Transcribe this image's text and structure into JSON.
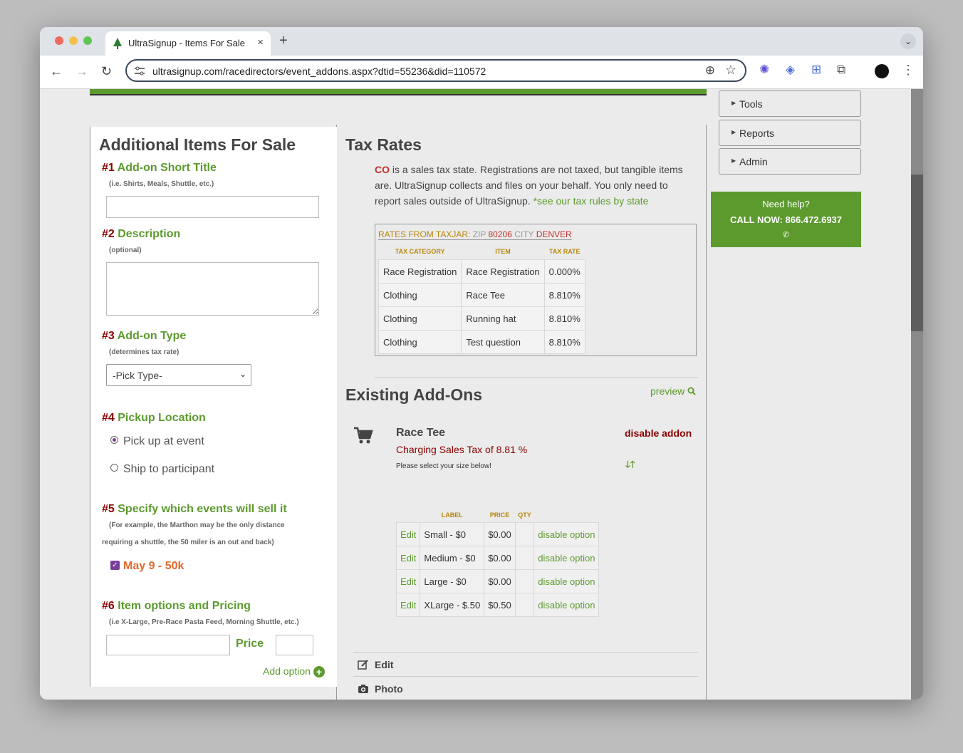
{
  "browser": {
    "tab_title": "UltraSignup - Items For Sale",
    "tab_close": "×",
    "new_tab": "+",
    "tab_menu": "⌄",
    "url": "ultrasignup.com/racedirectors/event_addons.aspx?dtid=55236&did=110572",
    "back": "←",
    "forward": "→",
    "reload": "↻",
    "zoom": "⊕",
    "star": "☆",
    "more": "⋮"
  },
  "colors": {
    "accent_green": "#5c9a2e",
    "dark_red": "#8b0000",
    "orange": "#e06a2b",
    "purple": "#7b3f98"
  },
  "left": {
    "title": "Additional Items For Sale",
    "step1": {
      "num": "#1",
      "label": "Add-on Short Title",
      "hint": "(i.e. Shirts, Meals, Shuttle, etc.)",
      "value": ""
    },
    "step2": {
      "num": "#2",
      "label": "Description",
      "hint": "(optional)",
      "value": ""
    },
    "step3": {
      "num": "#3",
      "label": "Add-on Type",
      "hint": "(determines tax rate)",
      "selected": "-Pick Type-"
    },
    "step4": {
      "num": "#4",
      "label": "Pickup Location",
      "options": [
        "Pick up at event",
        "Ship to participant"
      ],
      "selected_index": 0
    },
    "step5": {
      "num": "#5",
      "label": "Specify which events will sell it",
      "hint_line1": "(For example, the Marthon may be the only distance",
      "hint_line2": "requiring a shuttle, the 50 miler is an out and back)",
      "event": "May 9 - 50k",
      "checked": true
    },
    "step6": {
      "num": "#6",
      "label": "Item options and Pricing",
      "hint": "(i.e X-Large, Pre-Race Pasta Feed, Morning Shuttle, etc.)",
      "price_label": "Price",
      "add_option": "Add option"
    }
  },
  "tax": {
    "title": "Tax Rates",
    "state": "CO",
    "para": " is a sales tax state. Registrations are not taxed, but tangible items are. UltraSignup collects and files on your behalf. You only need to report sales outside of UltraSignup. ",
    "link": "*see our tax rules by state",
    "rates_label": "RATES FROM TAXJAR:",
    "zip_label": "ZIP",
    "zip": "80206",
    "city_label": "CITY",
    "city": "DENVER",
    "headers": [
      "TAX CATEGORY",
      "ITEM",
      "TAX RATE"
    ],
    "rows": [
      [
        "Race Registration",
        "Race Registration",
        "0.000%"
      ],
      [
        "Clothing",
        "Race Tee",
        "8.810%"
      ],
      [
        "Clothing",
        "Running hat",
        "8.810%"
      ],
      [
        "Clothing",
        "Test question",
        "8.810%"
      ]
    ]
  },
  "existing": {
    "title": "Existing Add-Ons",
    "preview": "preview",
    "addon_title": "Race Tee",
    "tax_line": "Charging Sales Tax of 8.81 %",
    "desc": "Please select your size below!",
    "disable_addon": "disable addon",
    "arrows": "🡓🡑",
    "headers": [
      "",
      "LABEL",
      "PRICE",
      "QTY",
      ""
    ],
    "options": [
      {
        "edit": "Edit",
        "label": "Small - $0",
        "price": "$0.00",
        "qty": "",
        "action": "disable option"
      },
      {
        "edit": "Edit",
        "label": "Medium - $0",
        "price": "$0.00",
        "qty": "",
        "action": "disable option"
      },
      {
        "edit": "Edit",
        "label": "Large - $0",
        "price": "$0.00",
        "qty": "",
        "action": "disable option"
      },
      {
        "edit": "Edit",
        "label": "XLarge - $.50",
        "price": "$0.50",
        "qty": "",
        "action": "disable option"
      }
    ],
    "edit_label": "Edit",
    "photo_label": "Photo"
  },
  "sidebar": {
    "items": [
      "Tools",
      "Reports",
      "Admin"
    ],
    "help_line1": "Need help?",
    "help_line2": "CALL NOW: 866.472.6937",
    "help_phone_icon": "✆"
  }
}
